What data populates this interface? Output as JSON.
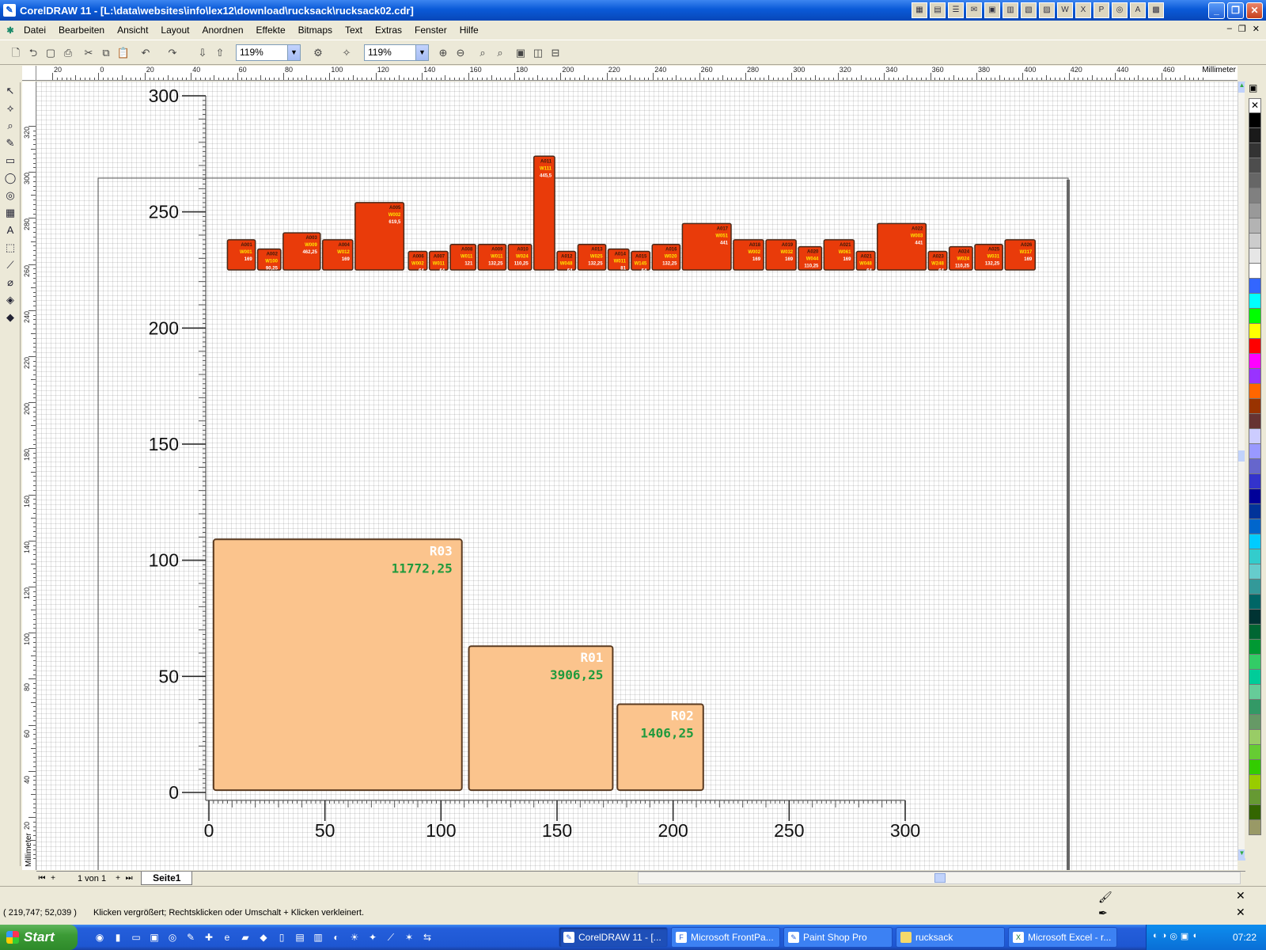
{
  "window": {
    "title": "CorelDRAW 11 - [L:\\data\\websites\\info\\lex12\\download\\rucksack\\rucksack02.cdr]"
  },
  "menu": {
    "items": [
      "Datei",
      "Bearbeiten",
      "Ansicht",
      "Layout",
      "Anordnen",
      "Effekte",
      "Bitmaps",
      "Text",
      "Extras",
      "Fenster",
      "Hilfe"
    ]
  },
  "toolbar": {
    "zoom_level": "119%",
    "zoom_level_2": "119%"
  },
  "rulers": {
    "unit": "Millimeter",
    "horizontal_labels": [
      "20",
      "0",
      "20",
      "40",
      "60",
      "80",
      "100",
      "120",
      "140",
      "160",
      "180",
      "200",
      "220",
      "240",
      "260",
      "280",
      "300",
      "320",
      "340",
      "360",
      "380",
      "400",
      "420",
      "440",
      "460"
    ],
    "vertical_labels": [
      "320",
      "300",
      "280",
      "260",
      "240",
      "220",
      "200",
      "180",
      "160",
      "140",
      "120",
      "100",
      "80",
      "60",
      "40",
      "20"
    ]
  },
  "chart_data": {
    "type": "bar",
    "xlim": [
      0,
      300
    ],
    "ylim": [
      0,
      300
    ],
    "x_ticks": [
      "0",
      "50",
      "100",
      "150",
      "200",
      "250",
      "300"
    ],
    "y_ticks": [
      "0",
      "50",
      "100",
      "150",
      "200",
      "250",
      "300"
    ],
    "containers": [
      {
        "id": "R03",
        "value": "11772,25",
        "x0": 2,
        "x1": 109,
        "y0": 1,
        "y1": 109
      },
      {
        "id": "R01",
        "value": "3906,25",
        "x0": 112,
        "x1": 174,
        "y0": 1,
        "y1": 63
      },
      {
        "id": "R02",
        "value": "1406,25",
        "x0": 176,
        "x1": 213,
        "y0": 1,
        "y1": 38
      }
    ],
    "items": [
      {
        "id": "A001",
        "w": "W001",
        "v": "169",
        "x0": 8,
        "x1": 20,
        "y0": 225,
        "y1": 238
      },
      {
        "id": "A002",
        "w": "W100",
        "v": "90,25",
        "x0": 21,
        "x1": 31,
        "y0": 225,
        "y1": 234
      },
      {
        "id": "A003",
        "w": "W009",
        "v": "462,25",
        "x0": 32,
        "x1": 48,
        "y0": 225,
        "y1": 241
      },
      {
        "id": "A004",
        "w": "W012",
        "v": "169",
        "x0": 49,
        "x1": 62,
        "y0": 225,
        "y1": 238
      },
      {
        "id": "A005",
        "w": "W002",
        "v": "619,5",
        "x0": 63,
        "x1": 84,
        "y0": 225,
        "y1": 254
      },
      {
        "id": "A006",
        "w": "W002",
        "v": "64",
        "x0": 86,
        "x1": 94,
        "y0": 225,
        "y1": 233
      },
      {
        "id": "A007",
        "w": "W011",
        "v": "64",
        "x0": 95,
        "x1": 103,
        "y0": 225,
        "y1": 233
      },
      {
        "id": "A008",
        "w": "W011",
        "v": "121",
        "x0": 104,
        "x1": 115,
        "y0": 225,
        "y1": 236
      },
      {
        "id": "A009",
        "w": "W011",
        "v": "132,25",
        "x0": 116,
        "x1": 128,
        "y0": 225,
        "y1": 236
      },
      {
        "id": "A010",
        "w": "W024",
        "v": "110,25",
        "x0": 129,
        "x1": 139,
        "y0": 225,
        "y1": 236
      },
      {
        "id": "A011",
        "w": "W111",
        "v": "445,5",
        "x0": 140,
        "x1": 149,
        "y0": 225,
        "y1": 274
      },
      {
        "id": "A012",
        "w": "W048",
        "v": "64",
        "x0": 150,
        "x1": 158,
        "y0": 225,
        "y1": 233
      },
      {
        "id": "A013",
        "w": "W025",
        "v": "132,25",
        "x0": 159,
        "x1": 171,
        "y0": 225,
        "y1": 236
      },
      {
        "id": "A014",
        "w": "W011",
        "v": "81",
        "x0": 172,
        "x1": 181,
        "y0": 225,
        "y1": 234
      },
      {
        "id": "A015",
        "w": "W145",
        "v": "64",
        "x0": 182,
        "x1": 190,
        "y0": 225,
        "y1": 233
      },
      {
        "id": "A016",
        "w": "W020",
        "v": "132,25",
        "x0": 191,
        "x1": 203,
        "y0": 225,
        "y1": 236
      },
      {
        "id": "A017",
        "w": "W051",
        "v": "441",
        "x0": 204,
        "x1": 225,
        "y0": 225,
        "y1": 245
      },
      {
        "id": "A018",
        "w": "W002",
        "v": "169",
        "x0": 226,
        "x1": 239,
        "y0": 225,
        "y1": 238
      },
      {
        "id": "A019",
        "w": "W032",
        "v": "169",
        "x0": 240,
        "x1": 253,
        "y0": 225,
        "y1": 238
      },
      {
        "id": "A020",
        "w": "W044",
        "v": "110,25",
        "x0": 254,
        "x1": 264,
        "y0": 225,
        "y1": 235
      },
      {
        "id": "A021",
        "w": "W061",
        "v": "169",
        "x0": 265,
        "x1": 278,
        "y0": 225,
        "y1": 238
      },
      {
        "id": "A021",
        "w": "W048",
        "v": "64",
        "x0": 279,
        "x1": 287,
        "y0": 225,
        "y1": 233
      },
      {
        "id": "A022",
        "w": "W003",
        "v": "441",
        "x0": 288,
        "x1": 309,
        "y0": 225,
        "y1": 245
      },
      {
        "id": "A023",
        "w": "W248",
        "v": "64",
        "x0": 310,
        "x1": 318,
        "y0": 225,
        "y1": 233
      },
      {
        "id": "A024",
        "w": "W024",
        "v": "110,25",
        "x0": 319,
        "x1": 329,
        "y0": 225,
        "y1": 235
      },
      {
        "id": "A025",
        "w": "W031",
        "v": "132,25",
        "x0": 330,
        "x1": 342,
        "y0": 225,
        "y1": 236
      },
      {
        "id": "A026",
        "w": "W317",
        "v": "169",
        "x0": 343,
        "x1": 356,
        "y0": 225,
        "y1": 238
      }
    ],
    "colors": {
      "container_fill": "#fbc48d",
      "container_stroke": "#5a3a20",
      "container_id_text": "#ffffff",
      "container_value_text": "#1f9a3c",
      "item_fill": "#e93b0a",
      "item_stroke": "#4a2a1a",
      "item_id_text": "#3a1a0a",
      "item_w_text": "#ffe600",
      "item_v_text": "#ffffff"
    }
  },
  "page_nav": {
    "page_count": "1 von 1",
    "tab_label": "Seite1"
  },
  "status": {
    "coords": "( 219,747; 52,039 )",
    "message": "Klicken vergrößert; Rechtsklicken oder Umschalt + Klicken verkleinert."
  },
  "taskbar": {
    "start_label": "Start",
    "tasks": [
      "CorelDRAW 11 - [...",
      "Microsoft FrontPa...",
      "Paint Shop Pro",
      "rucksack",
      "Microsoft Excel - r..."
    ],
    "clock": "07:22"
  },
  "palette": {
    "colors": [
      "#000000",
      "#1a1a1a",
      "#333333",
      "#4d4d4d",
      "#666666",
      "#808080",
      "#999999",
      "#b3b3b3",
      "#cccccc",
      "#e6e6e6",
      "#ffffff",
      "#3366ff",
      "#00ffff",
      "#00ff00",
      "#ffff00",
      "#ff0000",
      "#ff00ff",
      "#9933ff",
      "#ff6600",
      "#993300",
      "#663333",
      "#ccccff",
      "#9999ff",
      "#6666cc",
      "#3333cc",
      "#000099",
      "#003399",
      "#0066cc",
      "#00ccff",
      "#33cccc",
      "#66cccc",
      "#339999",
      "#006666",
      "#003333",
      "#006633",
      "#009933",
      "#33cc66",
      "#00cc99",
      "#66cc99",
      "#339966",
      "#669966",
      "#99cc66",
      "#66cc33",
      "#33cc00",
      "#99cc00",
      "#669933",
      "#336600",
      "#999966"
    ]
  }
}
